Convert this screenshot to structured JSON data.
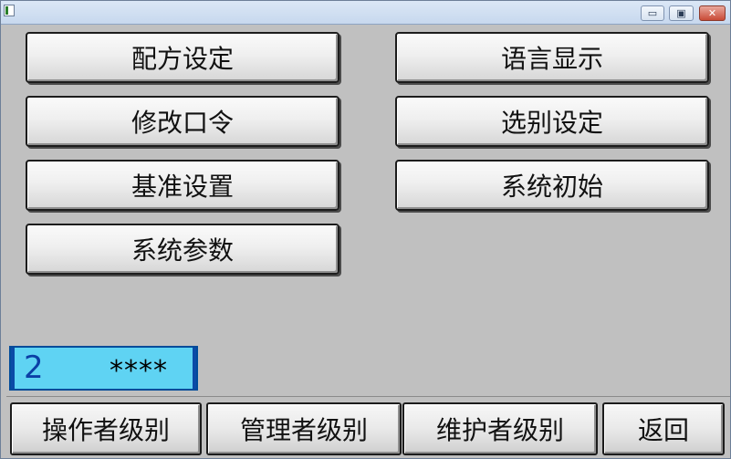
{
  "window": {
    "minimize_glyph": "▭",
    "restore_glyph": "▣",
    "close_glyph": "✕"
  },
  "menu": {
    "left": [
      "配方设定",
      "修改口令",
      "基准设置",
      "系统参数"
    ],
    "right": [
      "语言显示",
      "选别设定",
      "系统初始"
    ]
  },
  "password_display": {
    "level": "2",
    "mask": "****"
  },
  "bottom": {
    "operator_level": "操作者级别",
    "manager_level": "管理者级别",
    "maintainer_level": "维护者级别",
    "back": "返回"
  },
  "colors": {
    "background": "#c0c0c0",
    "password_bg": "#5fd3f3",
    "password_accent": "#0b4aa6"
  }
}
